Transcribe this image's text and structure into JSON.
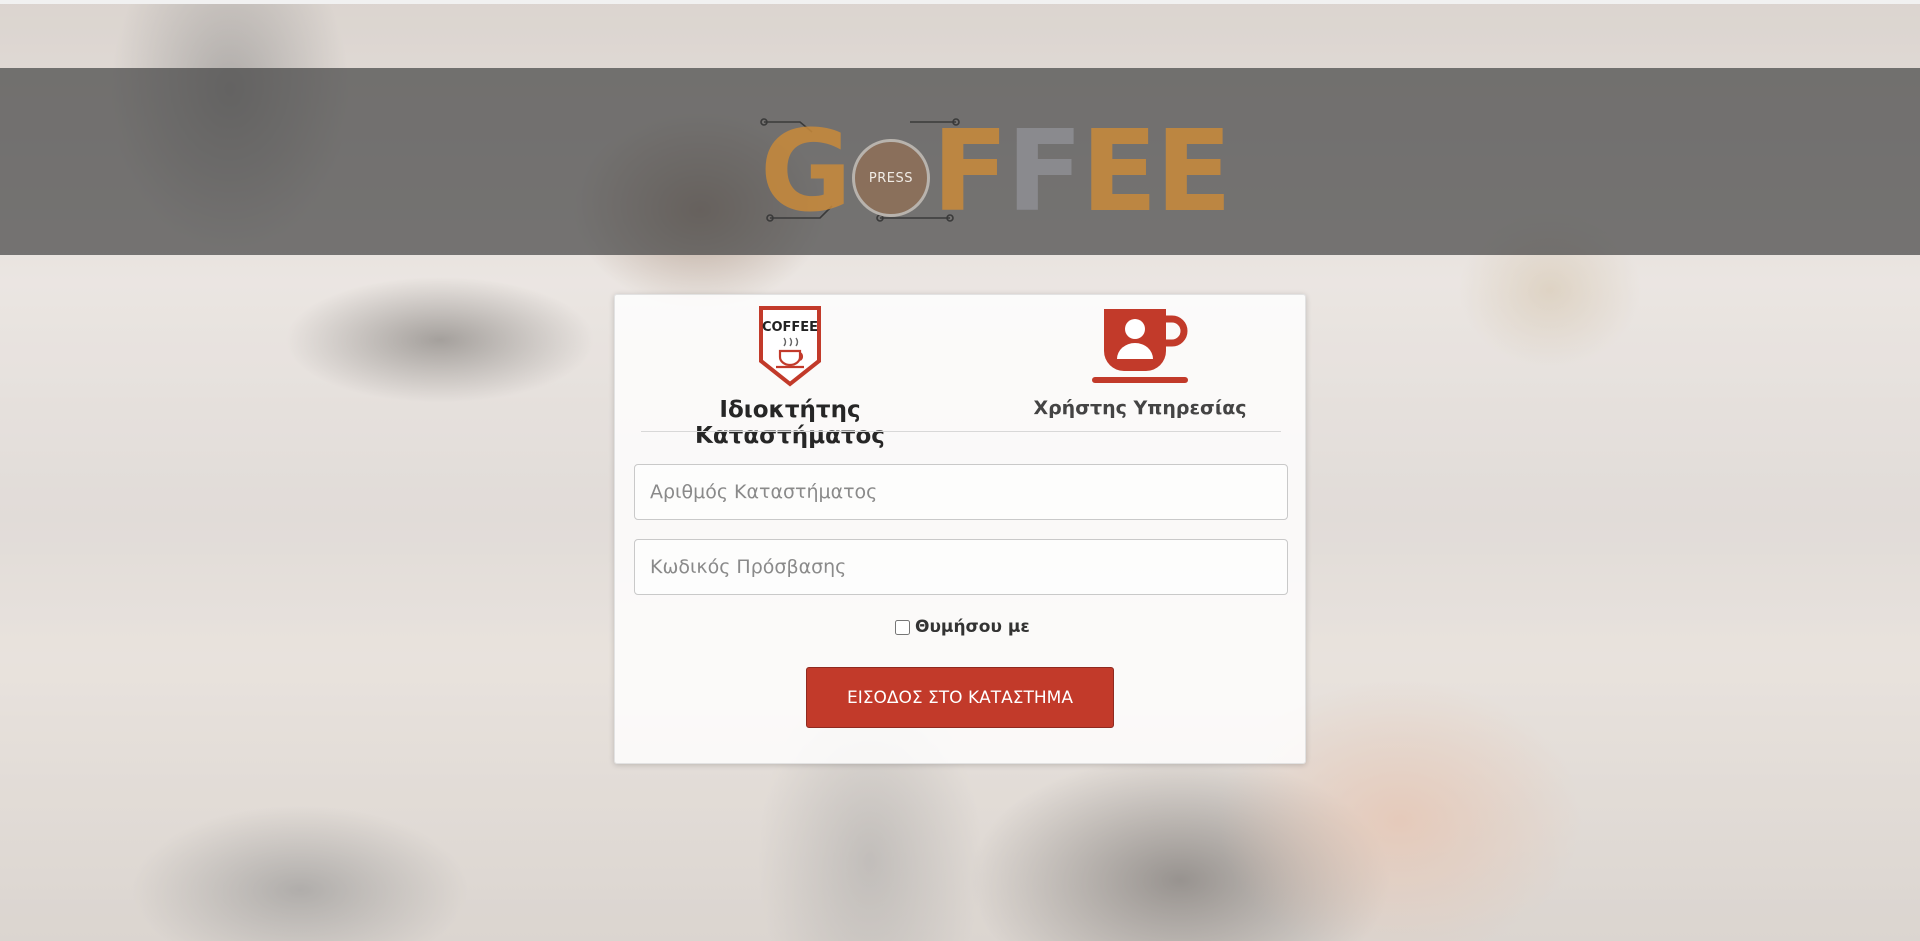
{
  "brand": {
    "logo_letters": [
      "G",
      "F",
      "F",
      "E",
      "E"
    ],
    "logo_o_text": "PRESS"
  },
  "login": {
    "owner_badge_text": "COFFEE",
    "owner_label": "Ιδιοκτήτης Καταστήματος",
    "user_label": "Χρήστης Υπηρεσίας",
    "store_number_placeholder": "Αριθμός Καταστήματος",
    "password_placeholder": "Κωδικός Πρόσβασης",
    "remember_label": "Θυμήσου με",
    "submit_label": "ΕΙΣΟΔΟΣ ΣΤΟ ΚΑΤΑΣΤΗΜΑ"
  },
  "colors": {
    "accent": "#c23a2a",
    "logo_orange": "#c98a3a",
    "logo_grey": "#8f8f94"
  },
  "icons": {
    "owner": "coffee-shop-badge-icon",
    "user": "coffee-cup-user-icon"
  }
}
